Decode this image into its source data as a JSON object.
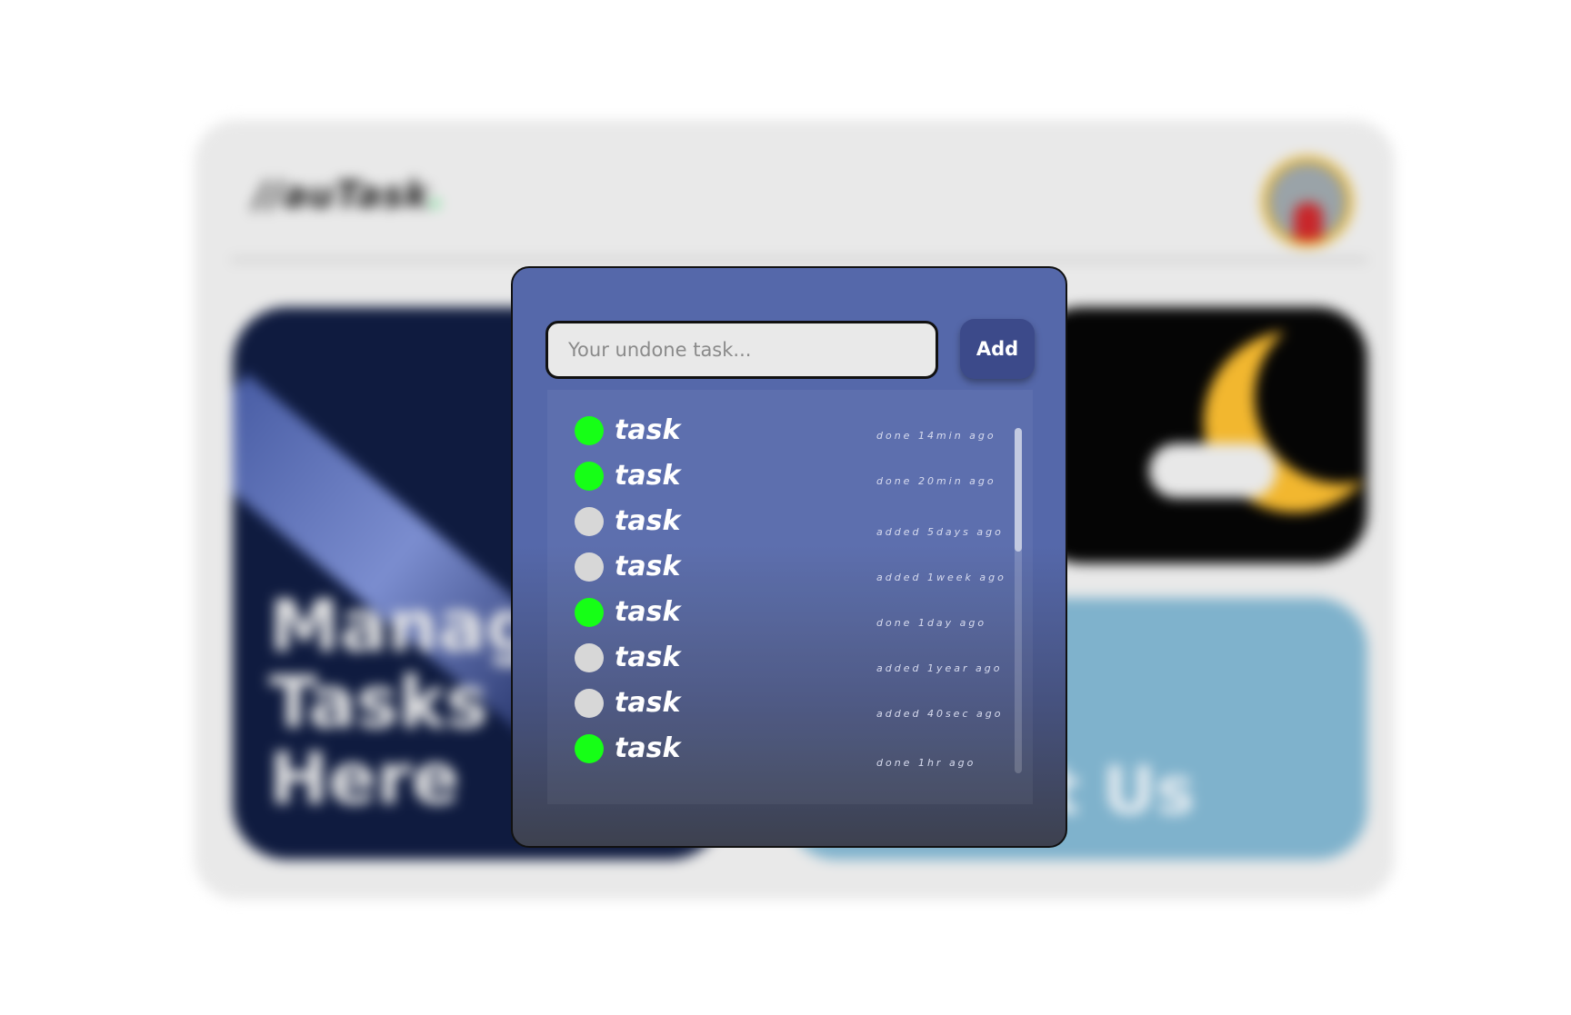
{
  "background": {
    "logo_text": "auTask",
    "logo_dot": ".",
    "card_manage_text": "Manage\nTasks\nHere",
    "card_contact_text": "Contact Us"
  },
  "form": {
    "placeholder": "Your undone task...",
    "value": "",
    "add_label": "Add"
  },
  "tasks": [
    {
      "label": "task",
      "done": true,
      "meta": "done 14min ago"
    },
    {
      "label": "task",
      "done": true,
      "meta": "done 20min ago"
    },
    {
      "label": "task",
      "done": false,
      "meta": "added 5days ago"
    },
    {
      "label": "task",
      "done": false,
      "meta": "added 1week ago"
    },
    {
      "label": "task",
      "done": true,
      "meta": "done 1day ago"
    },
    {
      "label": "task",
      "done": false,
      "meta": "added 1year ago"
    },
    {
      "label": "task",
      "done": false,
      "meta": "added 40sec ago"
    },
    {
      "label": "task",
      "done": true,
      "meta": "done 1hr ago"
    }
  ],
  "colors": {
    "modal": "#5568aa",
    "done": "#16ff16",
    "undone": "#d7d7d7",
    "add_button": "#3c4a8a"
  }
}
